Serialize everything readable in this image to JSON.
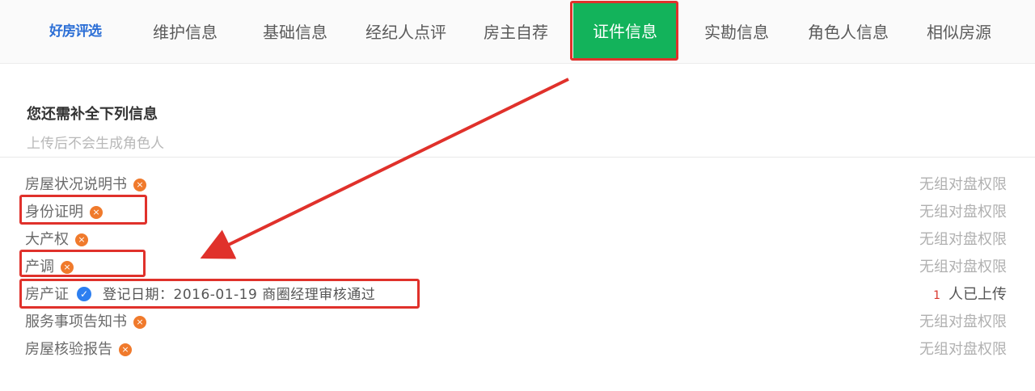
{
  "tabs": {
    "brand": "好房评选",
    "items": [
      "维护信息",
      "基础信息",
      "经纪人点评",
      "房主自荐",
      "证件信息",
      "实勘信息",
      "角色人信息",
      "相似房源"
    ],
    "active_index": 4
  },
  "section": {
    "title": "您还需补全下列信息",
    "subtitle": "上传后不会生成角色人"
  },
  "documents": [
    {
      "name": "房屋状况说明书",
      "status": "missing",
      "permission": "无组对盘权限"
    },
    {
      "name": "身份证明",
      "status": "missing",
      "permission": "无组对盘权限"
    },
    {
      "name": "大产权",
      "status": "missing",
      "permission": "无组对盘权限"
    },
    {
      "name": "产调",
      "status": "missing",
      "permission": "无组对盘权限"
    },
    {
      "name": "房产证",
      "status": "verified",
      "detail": "登记日期：2016-01-19 商圈经理审核通过",
      "upload_count": "1",
      "upload_label": "人已上传"
    },
    {
      "name": "服务事项告知书",
      "status": "missing",
      "permission": "无组对盘权限"
    },
    {
      "name": "房屋核验报告",
      "status": "missing",
      "permission": "无组对盘权限"
    }
  ],
  "icons": {
    "missing": "×",
    "verified": "✓"
  },
  "colors": {
    "active_tab": "#13b35b",
    "highlight": "#e0312b",
    "missing_badge": "#f07a2c",
    "verified_badge": "#2d7ff0"
  }
}
